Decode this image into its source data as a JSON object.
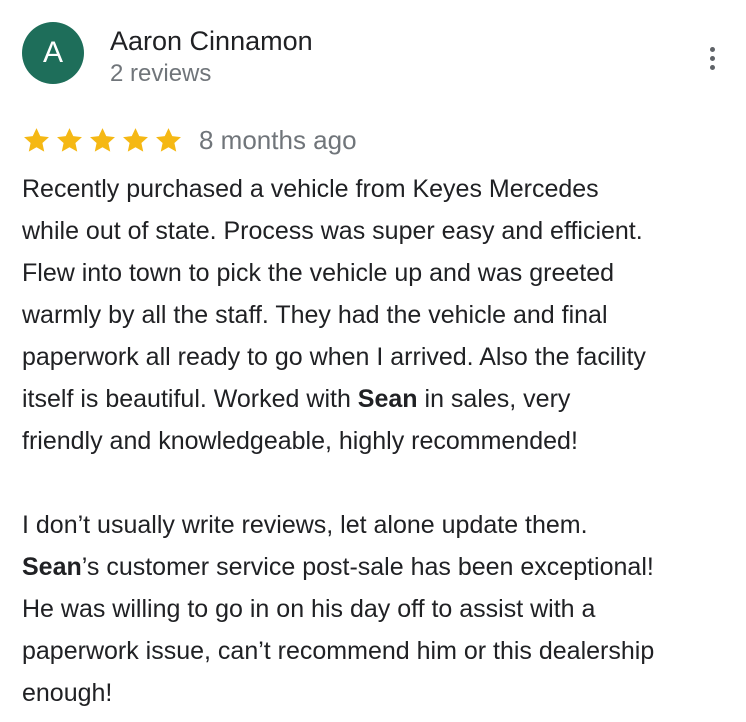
{
  "reviewer": {
    "avatar_letter": "A",
    "avatar_color": "#1e6e5a",
    "name": "Aaron Cinnamon",
    "review_count": "2 reviews"
  },
  "menu": {
    "icon": "more-vert-icon"
  },
  "rating": {
    "stars": 5,
    "max_stars": 5,
    "star_color": "#f5b814",
    "time_ago": "8 months ago"
  },
  "review": {
    "paragraph1": {
      "lines": [
        "Recently purchased a vehicle from Keyes Mercedes",
        "while out of state. Process was super easy and efficient.",
        "Flew into town to pick the vehicle up and was greeted",
        "warmly by all the staff. They had the vehicle and final",
        "paperwork all ready to go when I arrived. Also the facility"
      ],
      "line6_before": "itself is beautiful. Worked with ",
      "line6_bold": "Sean",
      "line6_after": " in sales, very",
      "line7": "friendly and knowledgeable, highly recommended!"
    },
    "paragraph2": {
      "line1": "I don’t usually write reviews, let alone update them.",
      "line2_bold": "Sean",
      "line2_after": "’s customer service post-sale has been exceptional!",
      "lines": [
        "He was willing to go in on his day off to assist with a",
        "paperwork issue, can’t recommend him or this dealership",
        "enough!"
      ]
    }
  }
}
